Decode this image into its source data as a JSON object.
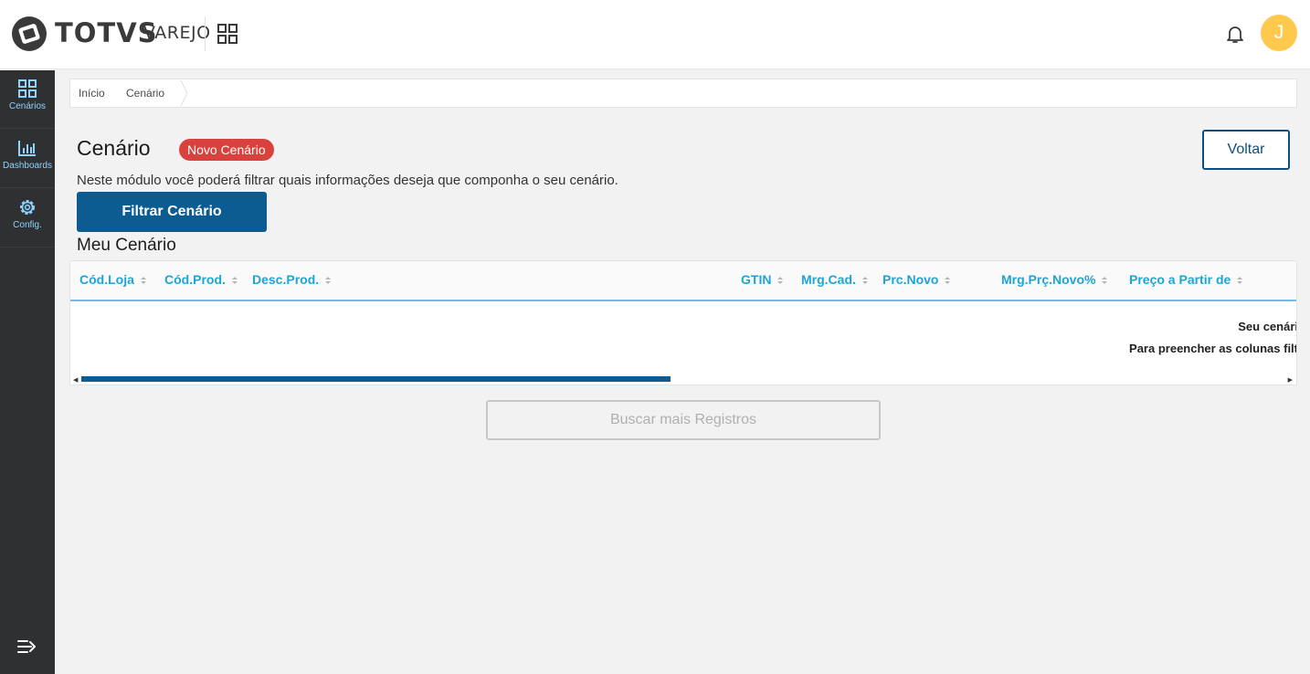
{
  "header": {
    "brand": "TOTVS",
    "brand_sub": "VAREJO",
    "avatar_initial": "J"
  },
  "sidebar": {
    "items": [
      {
        "label": "Cenários",
        "icon": "grid-icon"
      },
      {
        "label": "Dashboards",
        "icon": "bar-chart-icon"
      },
      {
        "label": "Config.",
        "icon": "gear-icon"
      }
    ]
  },
  "breadcrumb": [
    "Início",
    "Cenário"
  ],
  "page": {
    "title": "Cenário",
    "badge": "Novo Cenário",
    "description": "Neste módulo você poderá filtrar quais informações deseja que componha o seu cenário.",
    "voltar_label": "Voltar",
    "filtrar_label": "Filtrar Cenário",
    "section_title": "Meu Cenário"
  },
  "table": {
    "columns": [
      "Cód.Loja",
      "Cód.Prod.",
      "Desc.Prod.",
      "GTIN",
      "Mrg.Cad.",
      "Prc.Novo",
      "Mrg.Prç.Novo%",
      "Preço a Partir de"
    ],
    "empty_line_1": "Seu cenári",
    "empty_line_2": "Para preencher as colunas filt"
  },
  "buscar_label": "Buscar mais Registros",
  "colors": {
    "primary": "#0c5b91",
    "badge": "#d9413d",
    "sidebar": "#2e3032",
    "avatar": "#ffc94d",
    "column_header": "#1ea5d4"
  }
}
